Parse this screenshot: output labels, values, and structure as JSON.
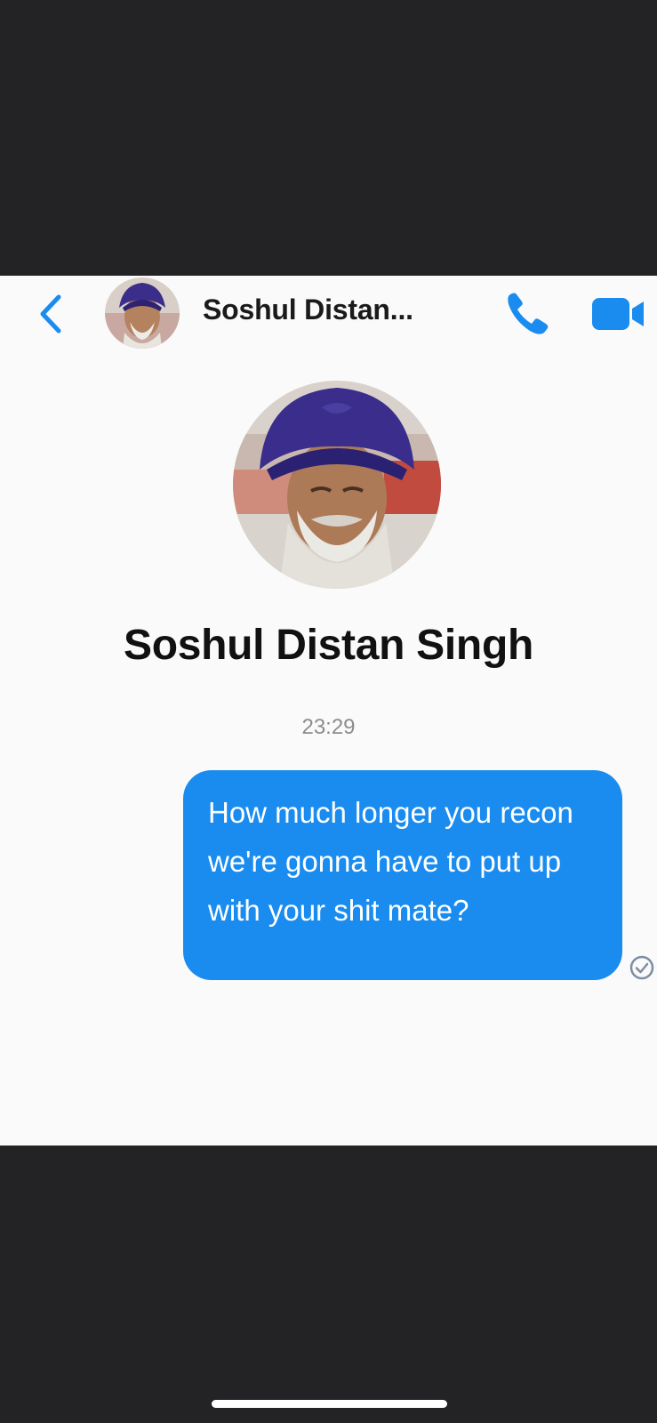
{
  "header": {
    "contact_name": "Soshul Distan...",
    "back_icon": "chevron-left-icon",
    "call_icon": "phone-icon",
    "video_icon": "video-camera-icon"
  },
  "profile": {
    "name": "Soshul Distan Singh"
  },
  "conversation": {
    "timestamp": "23:29",
    "messages": [
      {
        "direction": "outgoing",
        "text": "How much longer you recon we're gonna have to put up with your shit mate?",
        "status_icon": "delivered-check-icon"
      }
    ]
  },
  "colors": {
    "accent": "#1a8cf0",
    "background_outer": "#232326",
    "background_panel": "#fafafa",
    "name_text": "#111111",
    "timestamp_text": "#8c8c8c"
  }
}
